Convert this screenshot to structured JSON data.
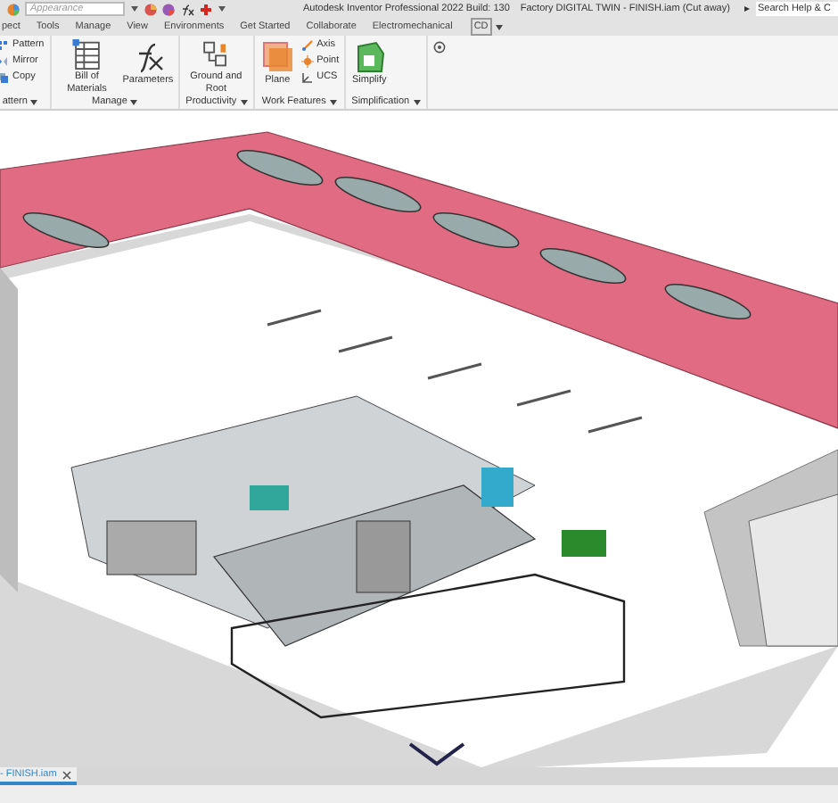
{
  "quick_access": {
    "appearance": {
      "placeholder": "Appearance"
    }
  },
  "window": {
    "title": "Autodesk Inventor Professional 2022 Build: 130",
    "document": "Factory DIGITAL TWIN - FINISH.iam (Cut away)"
  },
  "search": {
    "placeholder": "Search Help & C"
  },
  "tabs": [
    {
      "label": "pect",
      "selected": false
    },
    {
      "label": "Tools",
      "selected": false
    },
    {
      "label": "Manage",
      "selected": false
    },
    {
      "label": "View",
      "selected": false
    },
    {
      "label": "Environments",
      "selected": false
    },
    {
      "label": "Get Started",
      "selected": false
    },
    {
      "label": "Collaborate",
      "selected": false
    },
    {
      "label": "Electromechanical",
      "selected": false
    },
    {
      "label": "CD",
      "selected": false
    }
  ],
  "panels": [
    {
      "title": "attern",
      "buttons": [
        {
          "kind": "small",
          "label": "Pattern"
        },
        {
          "kind": "small",
          "label": "Mirror"
        },
        {
          "kind": "small",
          "label": "Copy"
        }
      ]
    },
    {
      "title": "Manage",
      "buttons": [
        {
          "kind": "large",
          "label": "Bill of Materials"
        },
        {
          "kind": "large",
          "label": "Parameters"
        }
      ]
    },
    {
      "title": "Productivity",
      "buttons": [
        {
          "kind": "large",
          "label": "Ground and Root"
        }
      ]
    },
    {
      "title": "Work Features",
      "buttons": [
        {
          "kind": "large",
          "label": "Plane"
        },
        {
          "kind": "small",
          "label": "Axis"
        },
        {
          "kind": "small",
          "label": "Point"
        },
        {
          "kind": "small",
          "label": "UCS"
        }
      ]
    },
    {
      "title": "Simplification",
      "buttons": [
        {
          "kind": "large",
          "label": "Simplify"
        }
      ]
    }
  ],
  "document_tabs": [
    {
      "label": "- FINISH.iam",
      "selected": true
    }
  ]
}
